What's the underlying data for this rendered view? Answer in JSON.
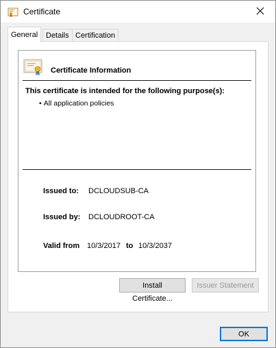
{
  "window": {
    "title": "Certificate",
    "title_icon": "certificate-icon",
    "close_icon": "close-x-icon"
  },
  "tabs": [
    {
      "label": "General",
      "active": true
    },
    {
      "label": "Details",
      "active": false
    },
    {
      "label": "Certification Path",
      "active": false
    }
  ],
  "general": {
    "header_title": "Certificate Information",
    "purpose_heading": "This certificate is intended for the following purpose(s):",
    "purposes": [
      "All application policies"
    ],
    "issued_to_label": "Issued to:",
    "issued_to_value": "DCLOUDSUB-CA",
    "issued_by_label": "Issued by:",
    "issued_by_value": "DCLOUDROOT-CA",
    "valid_from_label": "Valid from",
    "valid_from_value": "10/3/2017",
    "valid_to_label": "to",
    "valid_to_value": "10/3/2037"
  },
  "buttons": {
    "install": "Install Certificate...",
    "issuer_statement": "Issuer Statement",
    "ok": "OK"
  },
  "colors": {
    "accent": "#0078d7",
    "dialog_bg": "#f0f0f0",
    "disabled_text": "#9a9a9a"
  }
}
